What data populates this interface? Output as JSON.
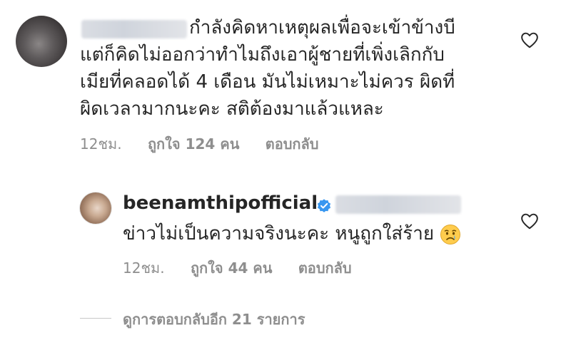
{
  "comment_1": {
    "lines": [
      "กำลังคิดหาเหตุผลเพื่อจะเข้าข้างบี",
      "แต่ก็คิดไม่ออกว่าทำไมถึงเอาผู้ชายที่เพิ่งเลิกกับ",
      "เมียที่คลอดได้ 4 เดือน มันไม่เหมาะไม่ควร ผิดที่",
      "ผิดเวลามากนะคะ สติต้องมาแล้วแหละ"
    ],
    "time": "12ชม.",
    "likes": "ถูกใจ 124 คน",
    "reply_label": "ตอบกลับ"
  },
  "reply_1": {
    "username": "beenamthipofficial",
    "text": "ข่าวไม่เป็นความจริงนะคะ หนูถูกใส่ร้าย",
    "time": "12ชม.",
    "likes": "ถูกใจ 44 คน",
    "reply_label": "ตอบกลับ"
  },
  "view_replies": "ดูการตอบกลับอีก 21 รายการ",
  "icons": {
    "heart": "heart-outline-icon",
    "verified": "verified-badge-icon",
    "emoji": "crying-face-emoji"
  },
  "colors": {
    "text": "#262626",
    "meta": "#8e8e8e",
    "verified": "#3897f0"
  }
}
